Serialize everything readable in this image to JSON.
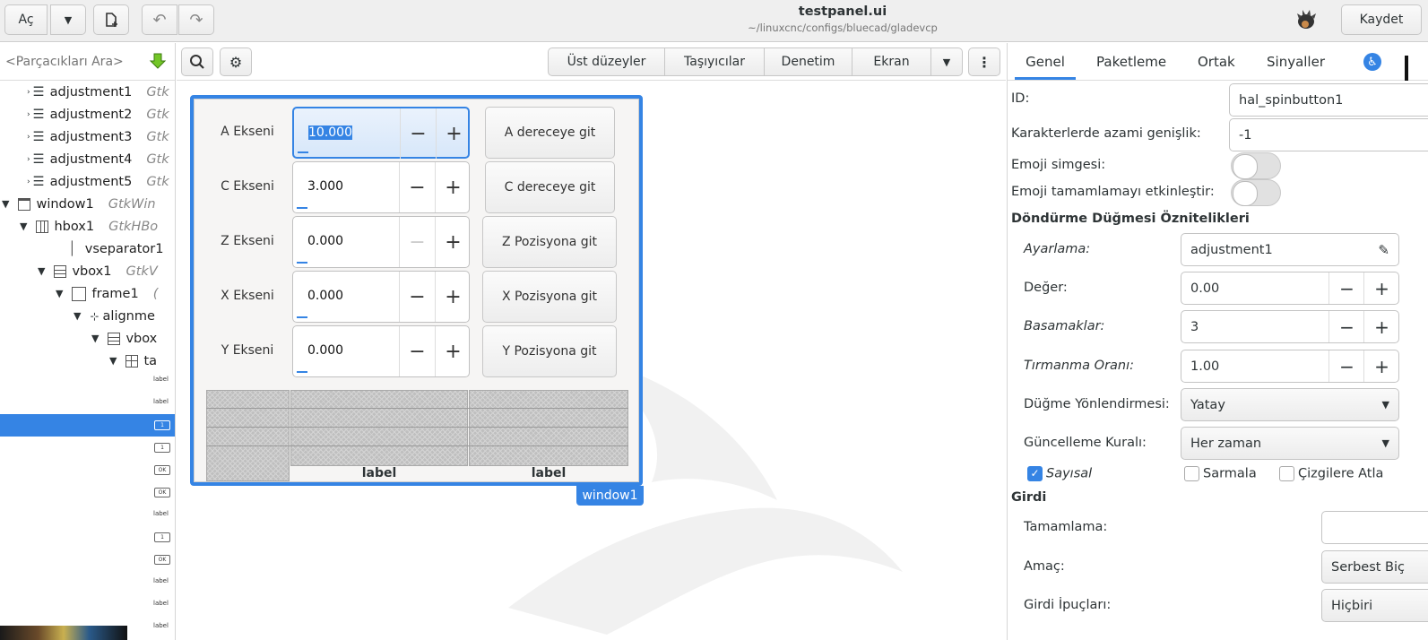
{
  "headerbar": {
    "open_label": "Aç",
    "title": "testpanel.ui",
    "subtitle": "~/linuxcnc/configs/bluecad/gladevcp",
    "save_label": "Kaydet"
  },
  "sidebar": {
    "search_placeholder": "<Parçacıkları Ara>",
    "tree": [
      {
        "name": "adjustment1",
        "type": "Gtk"
      },
      {
        "name": "adjustment2",
        "type": "Gtk"
      },
      {
        "name": "adjustment3",
        "type": "Gtk"
      },
      {
        "name": "adjustment4",
        "type": "Gtk"
      },
      {
        "name": "adjustment5",
        "type": "Gtk"
      },
      {
        "name": "window1",
        "type": "GtkWin"
      },
      {
        "name": "hbox1",
        "type": "GtkHBo"
      },
      {
        "name": "vseparator1",
        "type": ""
      },
      {
        "name": "vbox1",
        "type": "GtkV"
      },
      {
        "name": "frame1",
        "type": "("
      },
      {
        "name": "alignme",
        "type": ""
      },
      {
        "name": "vbox",
        "type": ""
      },
      {
        "name": "ta",
        "type": ""
      }
    ],
    "mini_label": "label",
    "mini_ok": "OK",
    "mini_spin": "1"
  },
  "toolbar": {
    "top_levels": "Üst düzeyler",
    "containers": "Taşıyıcılar",
    "control": "Denetim",
    "display": "Ekran"
  },
  "canvas": {
    "rows": [
      {
        "label": "A Ekseni",
        "value": "10.000",
        "button": "A dereceye git"
      },
      {
        "label": "C Ekseni",
        "value": "3.000",
        "button": "C dereceye git"
      },
      {
        "label": "Z Ekseni",
        "value": "0.000",
        "button": "Z Pozisyona git"
      },
      {
        "label": "X Ekseni",
        "value": "0.000",
        "button": "X Pozisyona git"
      },
      {
        "label": "Y Ekseni",
        "value": "0.000",
        "button": "Y Pozisyona git"
      }
    ],
    "bottom_label_1": "label",
    "bottom_label_2": "label",
    "window_tag": "window1",
    "minus": "−",
    "plus": "+"
  },
  "props": {
    "tabs": [
      "Genel",
      "Paketleme",
      "Ortak",
      "Sinyaller"
    ],
    "id_label": "ID:",
    "id_value": "hal_spinbutton1",
    "max_width_label": "Karakterlerde azami genişlik:",
    "max_width_value": "-1",
    "emoji_icon_label": "Emoji simgesi:",
    "emoji_completion_label": "Emoji tamamlamayı etkinleştir:",
    "spin_section": "Döndürme Düğmesi Öznitelikleri",
    "adjustment_label": "Ayarlama:",
    "adjustment_value": "adjustment1",
    "value_label": "Değer:",
    "value_value": "0.00",
    "digits_label": "Basamaklar:",
    "digits_value": "3",
    "climb_label": "Tırmanma Oranı:",
    "climb_value": "1.00",
    "orientation_label": "Düğme Yönlendirmesi:",
    "orientation_value": "Yatay",
    "update_label": "Güncelleme Kuralı:",
    "update_value": "Her zaman",
    "numeric_label": "Sayısal",
    "wrap_label": "Sarmala",
    "snap_label": "Çizgilere Atla",
    "input_section": "Girdi",
    "completion_label": "Tamamlama:",
    "purpose_label": "Amaç:",
    "purpose_value": "Serbest Biç",
    "hints_label": "Girdi İpuçları:",
    "hints_value": "Hiçbiri"
  },
  "colors": {
    "accent": "#3584e4"
  }
}
